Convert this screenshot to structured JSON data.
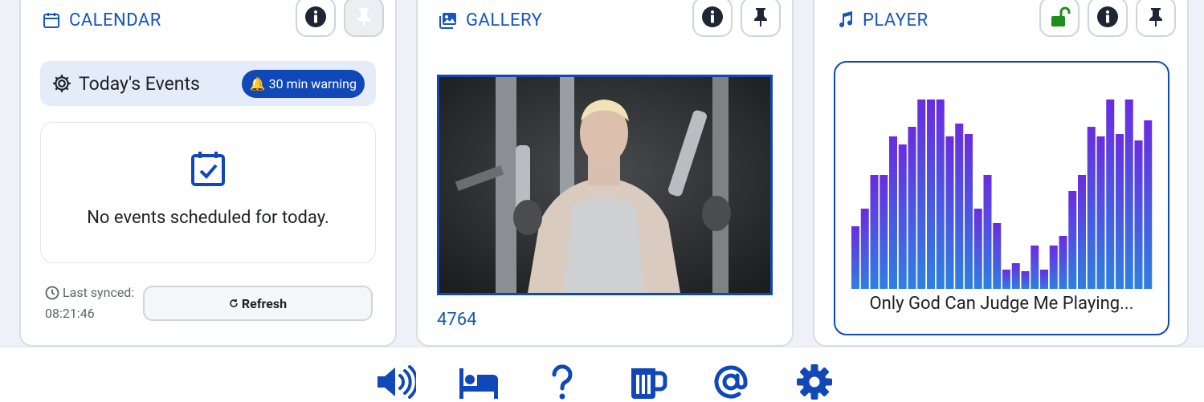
{
  "colors": {
    "accent": "#1148b7",
    "title": "#1555c0",
    "unlock": "#1e8e1e"
  },
  "calendar": {
    "title": "CALENDAR",
    "icon": "calendar-icon",
    "events_title": "Today's Events",
    "warning_badge": "🔔 30 min warning",
    "empty_message": "No events scheduled for today.",
    "last_synced_label": "Last synced:",
    "last_synced_time": "08:21:46",
    "refresh_label": "Refresh"
  },
  "gallery": {
    "title": "GALLERY",
    "icon": "image-icon",
    "photo_id": "4764"
  },
  "player": {
    "title": "PLAYER",
    "icon": "music-note-icon",
    "track": "Only God Can Judge Me Playing..."
  },
  "bottom_nav": [
    "volume-icon",
    "bed-icon",
    "help-icon",
    "mug-icon",
    "at-icon",
    "settings-icon"
  ]
}
